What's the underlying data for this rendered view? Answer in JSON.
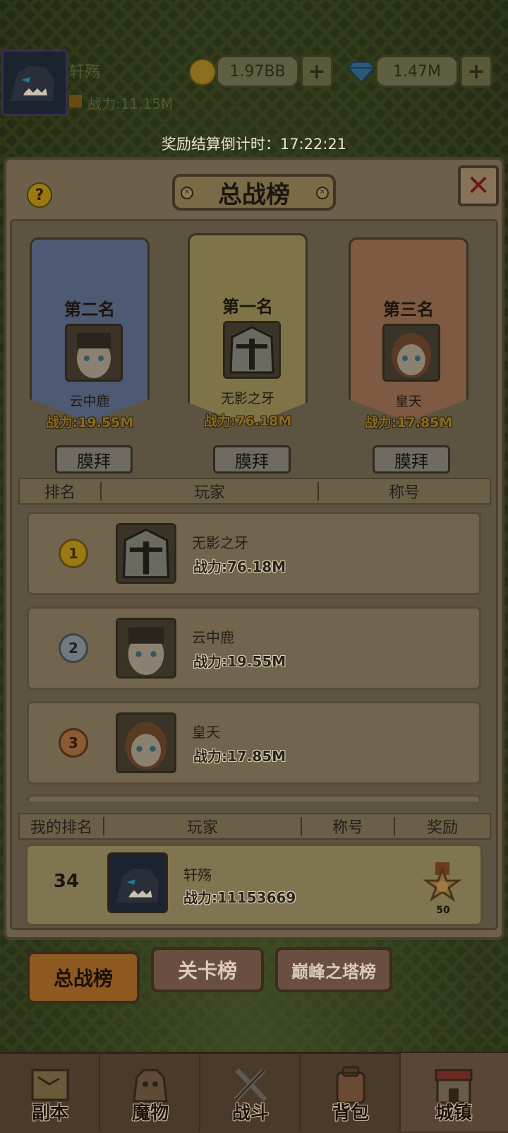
{
  "player": {
    "name": "轩殇",
    "power": "战力:11.15M"
  },
  "currency": {
    "gold": "1.97BB",
    "gems": "1.47M",
    "plus": "+"
  },
  "timer": "奖励结算倒计时：17:22:21",
  "panel": {
    "title": "总战榜",
    "help": "?",
    "close": "✕"
  },
  "podium": [
    {
      "rank_label": "第二名",
      "name": "云中鹿",
      "power": "战力:19.55M",
      "action": "膜拜"
    },
    {
      "rank_label": "第一名",
      "name": "无影之牙",
      "power": "战力:76.18M",
      "action": "膜拜"
    },
    {
      "rank_label": "第三名",
      "name": "皇天",
      "power": "战力:17.85M",
      "action": "膜拜"
    }
  ],
  "table_headers": {
    "rank": "排名",
    "player": "玩家",
    "title": "称号"
  },
  "rows": [
    {
      "rank": "1",
      "name": "无影之牙",
      "power": "战力:76.18M"
    },
    {
      "rank": "2",
      "name": "云中鹿",
      "power": "战力:19.55M"
    },
    {
      "rank": "3",
      "name": "皇天",
      "power": "战力:17.85M"
    }
  ],
  "my_headers": {
    "rank": "我的排名",
    "player": "玩家",
    "title": "称号",
    "reward": "奖励"
  },
  "my_row": {
    "rank": "34",
    "name": "轩殇",
    "power": "战力:11153669",
    "reward_count": "50"
  },
  "tabs": [
    {
      "label": "总战榜",
      "active": true
    },
    {
      "label": "关卡榜",
      "active": false
    },
    {
      "label": "巅峰之塔榜",
      "active": false
    }
  ],
  "nav": [
    {
      "label": "副本",
      "icon": "map-icon"
    },
    {
      "label": "魔物",
      "icon": "monster-icon"
    },
    {
      "label": "战斗",
      "icon": "swords-icon"
    },
    {
      "label": "背包",
      "icon": "backpack-icon"
    },
    {
      "label": "城镇",
      "icon": "town-icon"
    }
  ],
  "colors": {
    "gold_medal": "#9a7a14",
    "silver_medal": "#707a80",
    "bronze_medal": "#8a5a34"
  }
}
